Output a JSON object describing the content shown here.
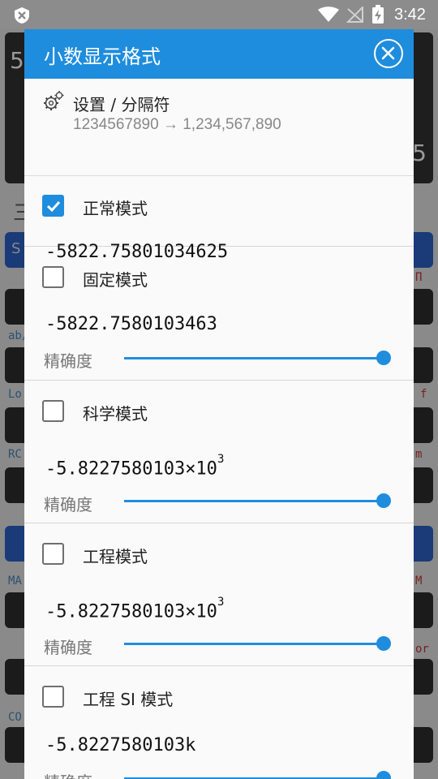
{
  "status_bar": {
    "time": "3:42",
    "icons": [
      "app-shield-icon",
      "wifi-icon",
      "no-signal-icon",
      "battery-charging-icon"
    ]
  },
  "background": {
    "display_digit_top": "5",
    "display_digit_bottom": "5",
    "menu_glyph": "三",
    "key_hint": "S",
    "labels_left": [
      "ab/",
      "Lo",
      "RC",
      "MA",
      "CO"
    ],
    "labels_right": [
      "Π",
      "f",
      "m",
      "M",
      "or"
    ]
  },
  "dialog": {
    "title": "小数显示格式",
    "settings": {
      "title": "设置 / 分隔符",
      "example": "1234567890 → 1,234,567,890"
    },
    "precision_label": "精确度",
    "modes": [
      {
        "label": "正常模式",
        "checked": true,
        "value": "-5822.75801034625"
      },
      {
        "label": "固定模式",
        "checked": false,
        "value": "-5822.7580103463",
        "precision": 1.0
      },
      {
        "label": "科学模式",
        "checked": false,
        "mantissa": "-5.8227580103",
        "times": "×10",
        "exponent": "3",
        "precision": 1.0
      },
      {
        "label": "工程模式",
        "checked": false,
        "mantissa": "-5.8227580103",
        "times": "×10",
        "exponent": "3",
        "precision": 1.0
      },
      {
        "label": "工程 SI 模式",
        "checked": false,
        "value": "-5.8227580103k",
        "precision": 1.0
      }
    ]
  },
  "colors": {
    "accent": "#1f8ddd",
    "status_bar": "#8c8c8c"
  }
}
